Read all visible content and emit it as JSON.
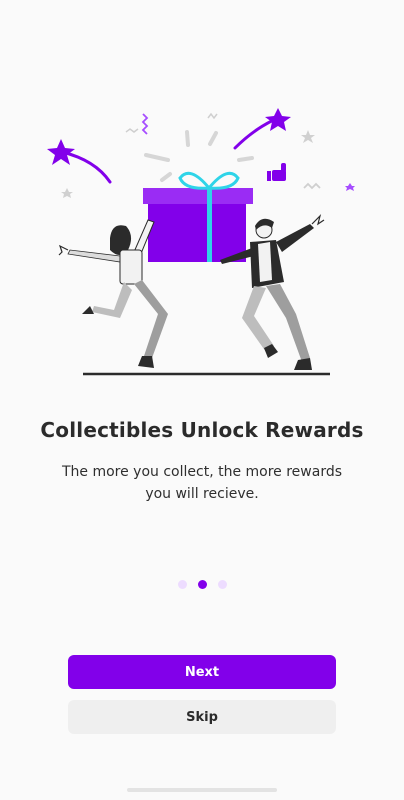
{
  "onboarding": {
    "title": "Collectibles Unlock Rewards",
    "subtitle": "The more you collect, the more rewards you will recieve.",
    "illustration_icon": "gift-celebration-illustration",
    "page_indicator": {
      "total": 3,
      "current": 2
    }
  },
  "actions": {
    "next_label": "Next",
    "skip_label": "Skip"
  },
  "colors": {
    "accent": "#8200ea",
    "accent_light": "#eddcff",
    "background": "#fafafa",
    "secondary_button": "#efefef",
    "text": "#2b2b2b"
  }
}
